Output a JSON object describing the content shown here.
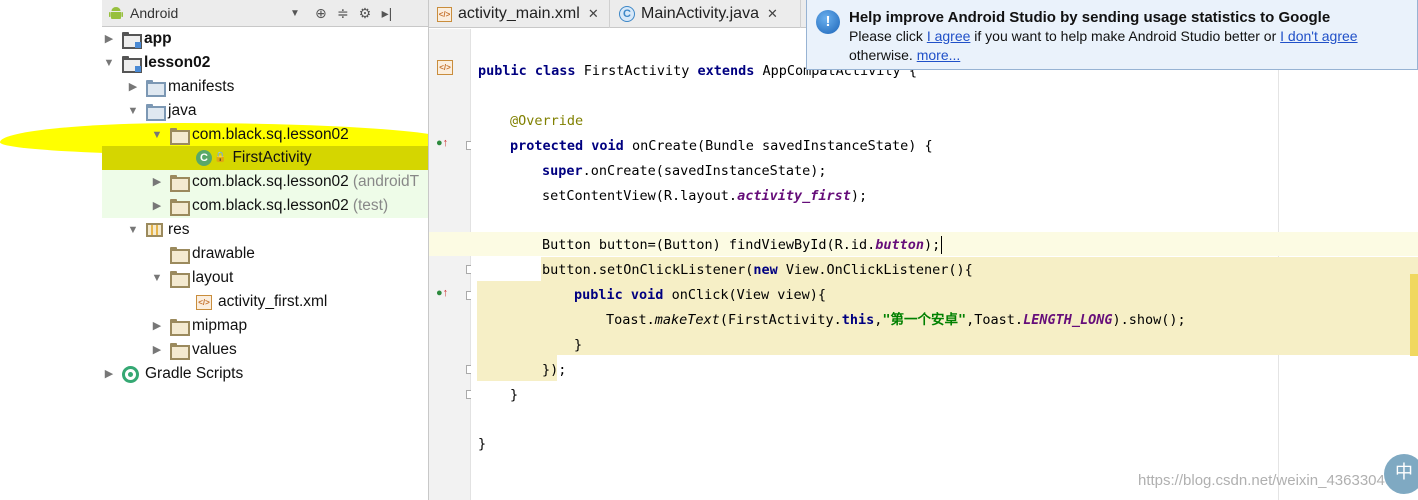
{
  "project_pane": {
    "view_select": "Android",
    "tree": [
      {
        "label": "app",
        "level": 0,
        "expanded": false
      },
      {
        "label": "lesson02",
        "level": 0,
        "expanded": true
      },
      {
        "label": "manifests",
        "level": 1,
        "expanded": false
      },
      {
        "label": "java",
        "level": 1,
        "expanded": true
      },
      {
        "label": "com.black.sq.lesson02",
        "level": 2,
        "expanded": true
      },
      {
        "label": "FirstActivity",
        "level": 3,
        "selected": true
      },
      {
        "label": "com.black.sq.lesson02",
        "suffix": "(androidT",
        "level": 2,
        "expanded": false
      },
      {
        "label": "com.black.sq.lesson02",
        "suffix": "(test)",
        "level": 2,
        "expanded": false
      },
      {
        "label": "res",
        "level": 1,
        "expanded": true
      },
      {
        "label": "drawable",
        "level": 2
      },
      {
        "label": "layout",
        "level": 2,
        "expanded": true
      },
      {
        "label": "activity_first.xml",
        "level": 3
      },
      {
        "label": "mipmap",
        "level": 2,
        "expanded": false
      },
      {
        "label": "values",
        "level": 2,
        "expanded": false
      },
      {
        "label": "Gradle Scripts",
        "level": 0,
        "expanded": false
      }
    ]
  },
  "tabs": [
    {
      "label": "activity_main.xml",
      "icon": "xml-file-icon"
    },
    {
      "label": "MainActivity.java",
      "icon": "class-icon"
    }
  ],
  "notification": {
    "title": "Help improve Android Studio by sending usage statistics to Google",
    "line1_prefix": "Please click ",
    "agree_link": "I agree",
    "line1_middle": " if you want to help make Android Studio better or ",
    "disagree_link": "I don't agree",
    "line2_prefix": "otherwise. ",
    "more_link": "more..."
  },
  "code": {
    "l1_public": "public",
    "l1_class": "class",
    "l1_name": " FirstActivity ",
    "l1_extends": "extends",
    "l1_rest": " AppCompatActivity {",
    "l2": "@Override",
    "l3_protected": "protected",
    "l3_void": "void",
    "l3_rest": " onCreate(Bundle savedInstanceState) {",
    "l4_super": "super",
    "l4_rest": ".onCreate(savedInstanceState);",
    "l5_a": "setContentView(R.layout.",
    "l5_field": "activity_first",
    "l5_b": ");",
    "l6_a": "Button button=(Button) findViewById(R.id.",
    "l6_field": "button",
    "l6_b": ");",
    "l7_a": "button.setOnClickListener(",
    "l7_new": "new",
    "l7_b": " View.OnClickListener(){",
    "l8_public": "public",
    "l8_void": "void",
    "l8_rest": " onClick(View view){",
    "l9_a": "Toast.",
    "l9_make": "makeText",
    "l9_b": "(FirstActivity.",
    "l9_this": "this",
    "l9_comma": ",",
    "l9_str": "\"第一个安卓\"",
    "l9_c": ",Toast.",
    "l9_len": "LENGTH_LONG",
    "l9_d": ").show();",
    "l10": "}",
    "l11": "});",
    "l12": "}",
    "l13": "}"
  },
  "watermark": "https://blog.csdn.net/weixin_43633040",
  "ime_badge": "中"
}
